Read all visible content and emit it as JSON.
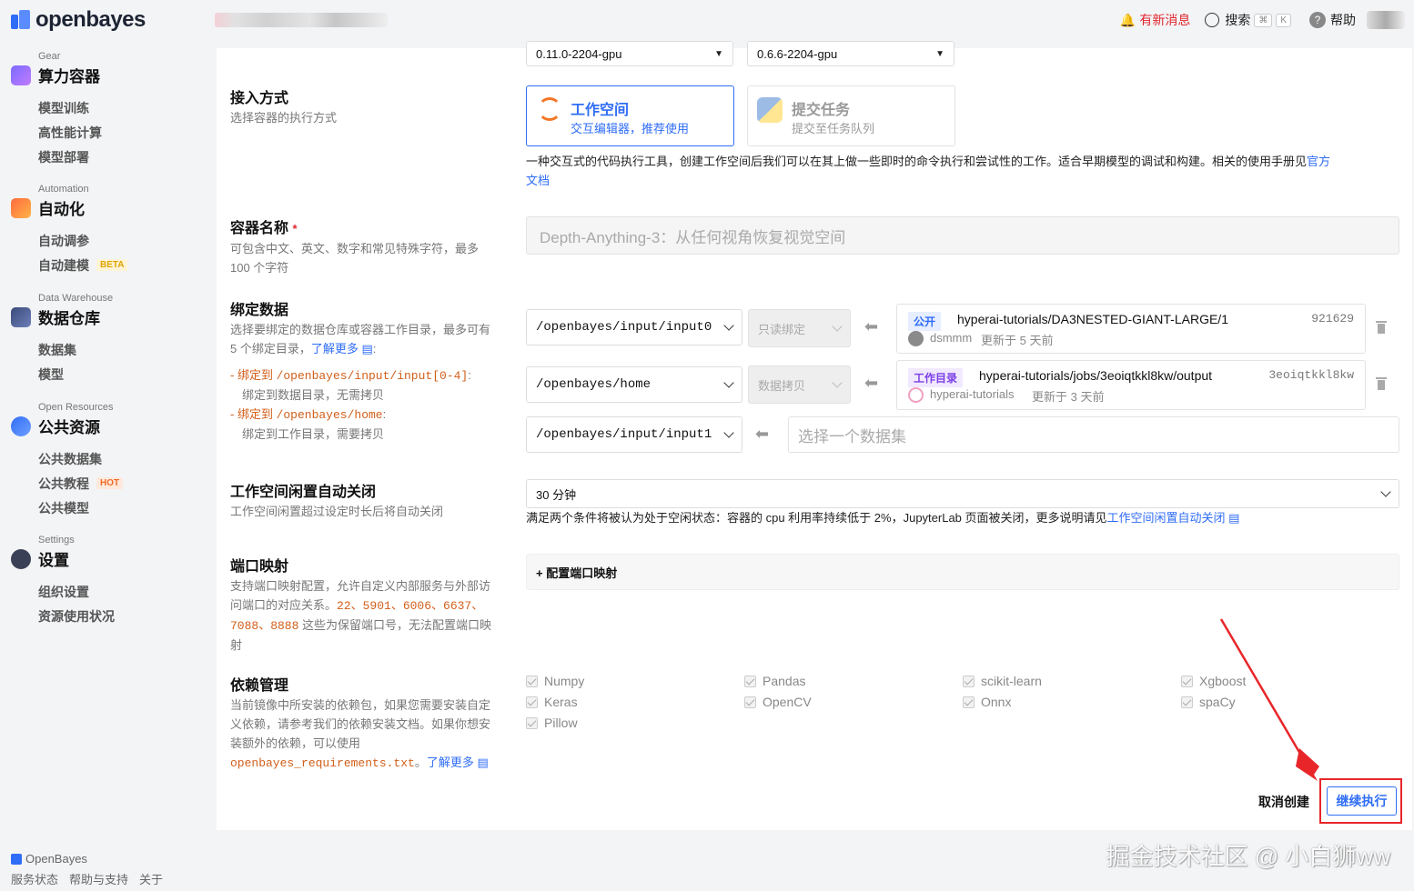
{
  "brand": {
    "name": "openbayes",
    "footer_name": "OpenBayes"
  },
  "topbar": {
    "news": "有新消息",
    "search": "搜索",
    "kbd1": "⌘",
    "kbd2": "K",
    "help": "帮助"
  },
  "sidebar": {
    "gear": {
      "eyebrow": "Gear",
      "title": "算力容器",
      "items": [
        "模型训练",
        "高性能计算",
        "模型部署"
      ]
    },
    "automation": {
      "eyebrow": "Automation",
      "title": "自动化",
      "items": [
        "自动调参",
        "自动建模"
      ],
      "beta": "BETA"
    },
    "warehouse": {
      "eyebrow": "Data Warehouse",
      "title": "数据仓库",
      "items": [
        "数据集",
        "模型"
      ]
    },
    "open": {
      "eyebrow": "Open Resources",
      "title": "公共资源",
      "items": [
        "公共数据集",
        "公共教程",
        "公共模型"
      ],
      "hot": "HOT"
    },
    "settings": {
      "eyebrow": "Settings",
      "title": "设置",
      "items": [
        "组织设置",
        "资源使用状况"
      ]
    }
  },
  "footer": {
    "links": [
      "服务状态",
      "帮助与支持",
      "关于"
    ]
  },
  "form": {
    "versions": {
      "left": "0.11.0-2204-gpu",
      "right": "0.6.6-2204-gpu"
    },
    "access": {
      "title": "接入方式",
      "desc": "选择容器的执行方式",
      "workspace_title": "工作空间",
      "workspace_sub": "交互编辑器，推荐使用",
      "task_title": "提交任务",
      "task_sub": "提交至任务队列",
      "explain": "一种交互式的代码执行工具，创建工作空间后我们可以在其上做一些即时的命令执行和尝试性的工作。适合早期模型的调试和构建。相关的使用手册见",
      "explain_link1": "官方",
      "explain_link2": "文档"
    },
    "name": {
      "title": "容器名称",
      "required": "*",
      "desc1": "可包含中文、英文、数字和常见特殊字符，最多",
      "desc2": "100 个字符",
      "value": "Depth-Anything-3：从任何视角恢复视觉空间"
    },
    "bind": {
      "title": "绑定数据",
      "desc1": "选择要绑定的数据仓库或容器工作目录，最多可有",
      "desc2": "5 个绑定目录，",
      "more": "了解更多",
      "rule1_prefix": "绑定到 ",
      "rule1_path": "/openbayes/input/input[0-4]",
      "rule1_desc": "绑定到数据目录，无需拷贝",
      "rule2_prefix": "绑定到 ",
      "rule2_path": "/openbayes/home",
      "rule2_desc": "绑定到工作目录，需要拷贝",
      "rows": [
        {
          "path": "/openbayes/input/input0",
          "mode": "只读绑定",
          "tag": "公开",
          "source": "hyperai-tutorials/DA3NESTED-GIANT-LARGE/1",
          "id": "921629",
          "owner": "dsmmm",
          "updated": "更新于 5 天前"
        },
        {
          "path": "/openbayes/home",
          "mode": "数据拷贝",
          "tag": "工作目录",
          "source": "hyperai-tutorials/jobs/3eoiqtkkl8kw/output",
          "id": "3eoiqtkkl8kw",
          "owner": "hyperai-tutorials",
          "updated": "更新于 3 天前"
        },
        {
          "path": "/openbayes/input/input1",
          "placeholder": "选择一个数据集"
        }
      ]
    },
    "idle": {
      "title": "工作空间闲置自动关闭",
      "desc": "工作空间闲置超过设定时长后将自动关闭",
      "value": "30 分钟",
      "note": "满足两个条件将被认为处于空闲状态：容器的 cpu 利用率持续低于 2%，JupyterLab 页面被关闭，更多说明请见",
      "note_link": "工作空间闲置自动关闭"
    },
    "port": {
      "title": "端口映射",
      "desc1": "支持端口映射配置，允许自定义内部服务与外部访",
      "desc2": "问端口的对应关系。",
      "ports_line1": "22、5901、6006、6637、",
      "ports_line2": "7088、8888",
      "desc3": " 这些为保留端口号，无法配置端口映",
      "desc4": "射",
      "button": "+ 配置端口映射"
    },
    "deps": {
      "title": "依赖管理",
      "desc1": "当前镜像中所安装的依赖包，如果您需要安装自定",
      "desc2": "义依赖，请参考我们的依赖安装文档。如果你想安",
      "desc3": "装额外的依赖，可以使用",
      "file": "openbayes_requirements.txt",
      "sep": "。",
      "more": "了解更多",
      "packages": [
        "Numpy",
        "Pandas",
        "scikit-learn",
        "Xgboost",
        "Keras",
        "OpenCV",
        "Onnx",
        "spaCy",
        "Pillow"
      ]
    },
    "actions": {
      "cancel": "取消创建",
      "continue": "继续执行"
    }
  },
  "watermark": "掘金技术社区 @ 小白狮ww",
  "colors": {
    "accent": "#2f6df6",
    "annotation_red": "#e8262a",
    "reserved_orange": "#d25f1a"
  }
}
